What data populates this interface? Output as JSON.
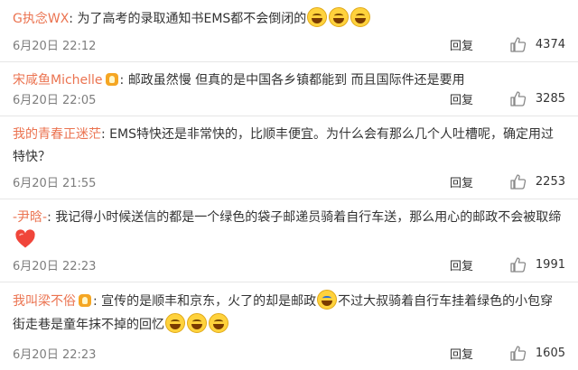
{
  "labels": {
    "reply": "回复"
  },
  "colors": {
    "username": "#eb7350",
    "time": "#7d7d7d",
    "divider": "#e6e6e6"
  },
  "comments": [
    {
      "user": "G执念WX",
      "colon": ":",
      "text": "为了高考的录取通知书EMS都不会倒闭的",
      "time": "6月20日 22:12",
      "likes": "4374"
    },
    {
      "user": "宋咸鱼Michelle",
      "colon": ":",
      "text": "邮政虽然慢 但真的是中国各乡镇都能到 而且国际件还是要用",
      "time": "6月20日 22:05",
      "likes": "3285"
    },
    {
      "user": "我的青春正迷茫",
      "colon": ":",
      "text": "EMS特快还是非常快的，比顺丰便宜。为什么会有那么几个人吐槽呢，确定用过特快？",
      "time": "6月20日 21:55",
      "likes": "2253"
    },
    {
      "user": "-尹晗-",
      "colon": ":",
      "text": "我记得小时候送信的都是一个绿色的袋子邮递员骑着自行车送，那么用心的邮政不会被取缔",
      "time": "6月20日 22:23",
      "likes": "1991"
    },
    {
      "user": "我叫梁不俗",
      "colon": ":",
      "text_a": "宣传的是顺丰和京东，火了的却是邮政",
      "text_b": "不过大叔骑着自行车挂着绿色的小包穿街走巷是童年抹不掉的回忆",
      "time": "6月20日 22:23",
      "likes": "1605"
    }
  ]
}
